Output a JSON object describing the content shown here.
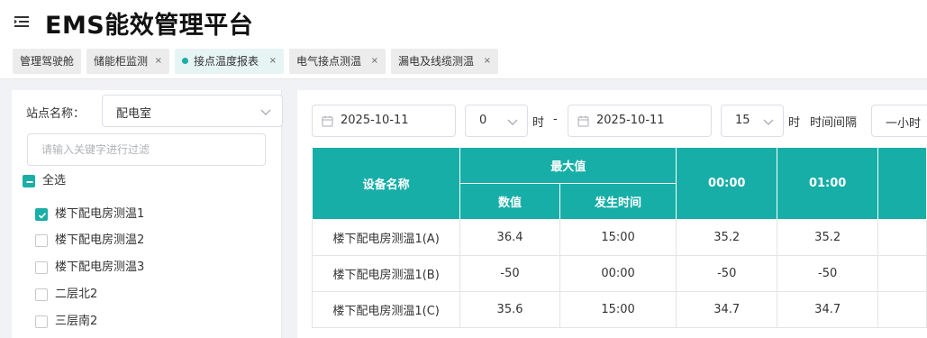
{
  "app": {
    "title": "EMS能效管理平台"
  },
  "tabs": [
    {
      "label": "管理驾驶舱",
      "closable": false,
      "active": false
    },
    {
      "label": "储能柜监测",
      "closable": true,
      "active": false
    },
    {
      "label": "接点温度报表",
      "closable": true,
      "active": true
    },
    {
      "label": "电气接点测温",
      "closable": true,
      "active": false
    },
    {
      "label": "漏电及线缆测温",
      "closable": true,
      "active": false
    }
  ],
  "tab_close_glyph": "×",
  "sidebar": {
    "station_label": "站点名称：",
    "station_value": "配电室",
    "filter_placeholder": "请输入关键字进行过滤",
    "select_all_label": "全选",
    "items": [
      {
        "label": "楼下配电房测温1",
        "checked": true
      },
      {
        "label": "楼下配电房测温2",
        "checked": false
      },
      {
        "label": "楼下配电房测温3",
        "checked": false
      },
      {
        "label": "二层北2",
        "checked": false
      },
      {
        "label": "三层南2",
        "checked": false
      }
    ]
  },
  "filters": {
    "start_date": "2025-10-11",
    "start_hour": "0",
    "hour_unit": "时",
    "separator": "-",
    "end_date": "2025-10-11",
    "end_hour": "15",
    "interval_label": "时间间隔",
    "interval_value": "一小时"
  },
  "table": {
    "device_col": "设备名称",
    "max_group": "最大值",
    "value_col": "数值",
    "time_col": "发生时间",
    "hour_cols": [
      "00:00",
      "01:00"
    ],
    "rows": [
      {
        "device": "楼下配电房测温1(A)",
        "max_value": "36.4",
        "max_time": "15:00",
        "hours": [
          "35.2",
          "35.2"
        ]
      },
      {
        "device": "楼下配电房测温1(B)",
        "max_value": "-50",
        "max_time": "00:00",
        "hours": [
          "-50",
          "-50"
        ]
      },
      {
        "device": "楼下配电房测温1(C)",
        "max_value": "35.6",
        "max_time": "15:00",
        "hours": [
          "34.7",
          "34.7"
        ]
      }
    ]
  },
  "colors": {
    "accent": "#17aea8"
  },
  "icons": {
    "menu": "menu-fold-icon",
    "calendar": "calendar-icon",
    "chevron": "chevron-down-icon"
  }
}
